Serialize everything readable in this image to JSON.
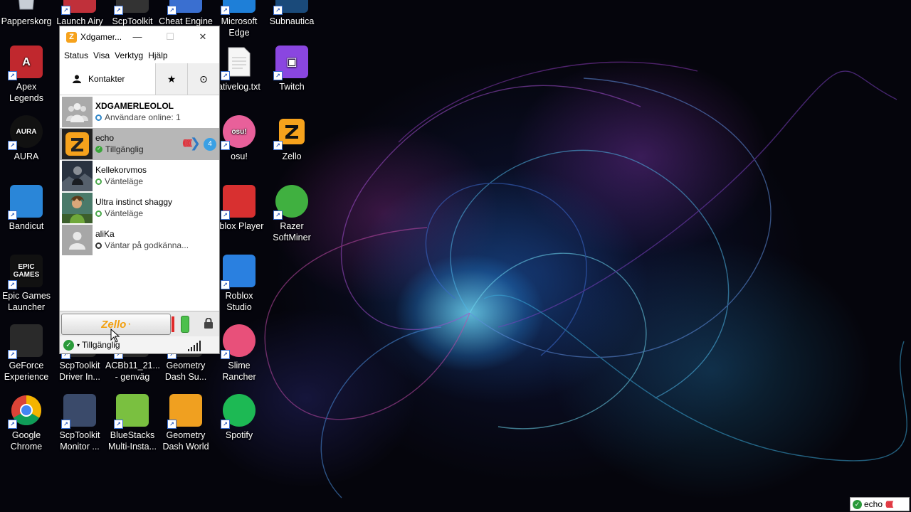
{
  "desktop": {
    "icons": [
      {
        "id": "papperskorg",
        "label": "Papperskorg"
      },
      {
        "id": "launch-airy",
        "label": "Launch Airy"
      },
      {
        "id": "scptoolkit",
        "label": "ScpToolkit"
      },
      {
        "id": "cheat-engine",
        "label": "Cheat Engine"
      },
      {
        "id": "microsoft-edge",
        "label": "Microsoft Edge"
      },
      {
        "id": "subnautica",
        "label": "Subnautica"
      },
      {
        "id": "apex",
        "label": "Apex Legends"
      },
      {
        "id": "nativelog",
        "label": "ativelog.txt"
      },
      {
        "id": "twitch",
        "label": "Twitch"
      },
      {
        "id": "aura",
        "label": "AURA"
      },
      {
        "id": "osu",
        "label": "osu!"
      },
      {
        "id": "zello",
        "label": "Zello"
      },
      {
        "id": "bandicut",
        "label": "Bandicut"
      },
      {
        "id": "roblox-player",
        "label": "oblox Player"
      },
      {
        "id": "razer",
        "label": "Razer SoftMiner"
      },
      {
        "id": "epic",
        "label": "Epic Games Launcher"
      },
      {
        "id": "roblox-studio",
        "label": "Roblox Studio"
      },
      {
        "id": "geforce",
        "label": "GeForce Experience"
      },
      {
        "id": "scp-driver",
        "label": "ScpToolkit Driver In..."
      },
      {
        "id": "acbb",
        "label": "ACBb11_21... - genväg"
      },
      {
        "id": "gd-sub",
        "label": "Geometry Dash Su..."
      },
      {
        "id": "slime",
        "label": "Slime Rancher"
      },
      {
        "id": "chrome",
        "label": "Google Chrome"
      },
      {
        "id": "scp-monitor",
        "label": "ScpToolkit Monitor ..."
      },
      {
        "id": "bluestacks",
        "label": "BlueStacks Multi-Insta..."
      },
      {
        "id": "gd-world",
        "label": "Geometry Dash World"
      },
      {
        "id": "spotify",
        "label": "Spotify"
      }
    ],
    "icon_art": {
      "apex": "A",
      "aura": "AURA",
      "epic": "EPIC\nGAMES",
      "osu": "osu!",
      "zello": "Z",
      "twitch": "▣"
    }
  },
  "zello": {
    "title": "Xdgamer...",
    "window_controls": {
      "minimize": "—",
      "maximize": "☐",
      "close": "✕"
    },
    "menu": [
      "Status",
      "Visa",
      "Verktyg",
      "Hjälp"
    ],
    "tabs": {
      "contacts": "Kontakter",
      "favorites_icon": "★",
      "recents_icon": "⊙"
    },
    "contacts": [
      {
        "name": "XDGAMERLEOLOL",
        "status": "Användare online: 1",
        "kind": "channel"
      },
      {
        "name": "echo",
        "status": "Tillgänglig",
        "kind": "selected",
        "badge": "4",
        "waves": "((((((("
      },
      {
        "name": "Kellekorvmos",
        "status": "Vänteläge",
        "kind": "standby"
      },
      {
        "name": "Ultra instinct shaggy",
        "status": "Vänteläge",
        "kind": "standby"
      },
      {
        "name": "aliKa",
        "status": "Väntar på godkänna...",
        "kind": "pending"
      }
    ],
    "talk_button": {
      "logo_main": "Zello"
    },
    "status_bar": {
      "status": "Tillgänglig",
      "check": "✓",
      "caret": "▾"
    }
  },
  "tray_notification": {
    "name": "echo",
    "waves": "((((((("
  },
  "colors": {
    "zello_orange": "#f6a21c",
    "available_green": "#3aa53a",
    "talk_red": "#e0303a"
  }
}
